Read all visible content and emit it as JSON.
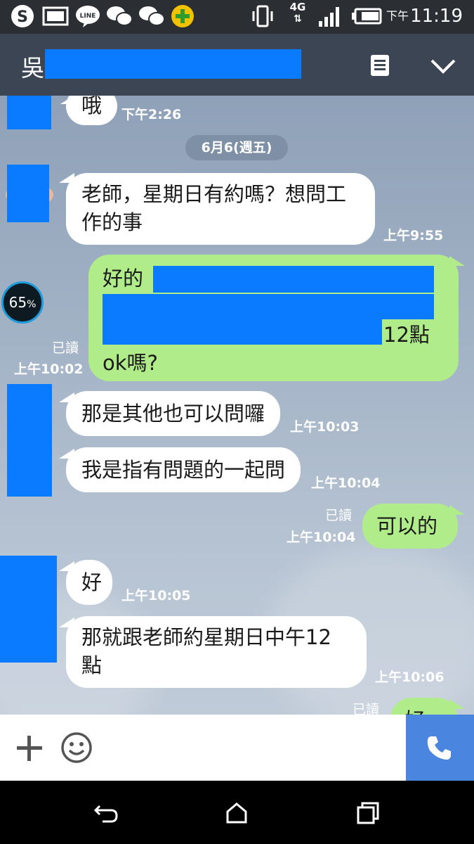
{
  "status_bar": {
    "network": "4G",
    "time_period": "下午",
    "time": "11:19",
    "icons": [
      "skype-icon",
      "gallery-icon",
      "line-icon",
      "wechat-icon",
      "wechat-icon",
      "app-plus-icon",
      "vibrate-icon",
      "network-4g-icon",
      "signal-icon",
      "battery-icon"
    ]
  },
  "header": {
    "title": "吳",
    "menu_icon": "notes-icon",
    "dropdown_icon": "chevron-down-icon"
  },
  "chat": {
    "date_separator": "6月6(週五)",
    "battery_widget": {
      "value": "65",
      "unit": "%"
    },
    "messages": [
      {
        "side": "in",
        "text": "哦",
        "time": "下午2:26"
      },
      {
        "side": "in",
        "line1": "老師，星期日有約嗎？想問工",
        "line2": "作的事",
        "time": "上午9:55"
      },
      {
        "side": "out",
        "line1": "好的",
        "line3": "12點",
        "line4": "ok嗎?",
        "read": "已讀",
        "time": "上午10:02"
      },
      {
        "side": "in",
        "text": "那是其他也可以問囉",
        "time": "上午10:03"
      },
      {
        "side": "in",
        "text": "我是指有問題的一起問",
        "time": "上午10:04"
      },
      {
        "side": "out",
        "text": "可以的",
        "read": "已讀",
        "time": "上午10:04"
      },
      {
        "side": "in",
        "text": "好",
        "time": "上午10:05"
      },
      {
        "side": "in",
        "line1": "那就跟老師約星期日中午12",
        "line2": "點",
        "time": "上午10:06"
      },
      {
        "side": "out",
        "text": "好的",
        "read": "已讀"
      }
    ]
  },
  "input_bar": {
    "add_icon": "plus-icon",
    "emoji_icon": "smile-icon",
    "call_icon": "phone-icon"
  },
  "nav_bar": {
    "icons": [
      "back-icon",
      "home-icon",
      "recents-icon"
    ]
  },
  "colors": {
    "header": "#3b4553",
    "incoming_bubble": "#ffffff",
    "outgoing_bubble": "#b1ec8a",
    "redaction": "#0a7bff",
    "call_button": "#4a86df"
  }
}
